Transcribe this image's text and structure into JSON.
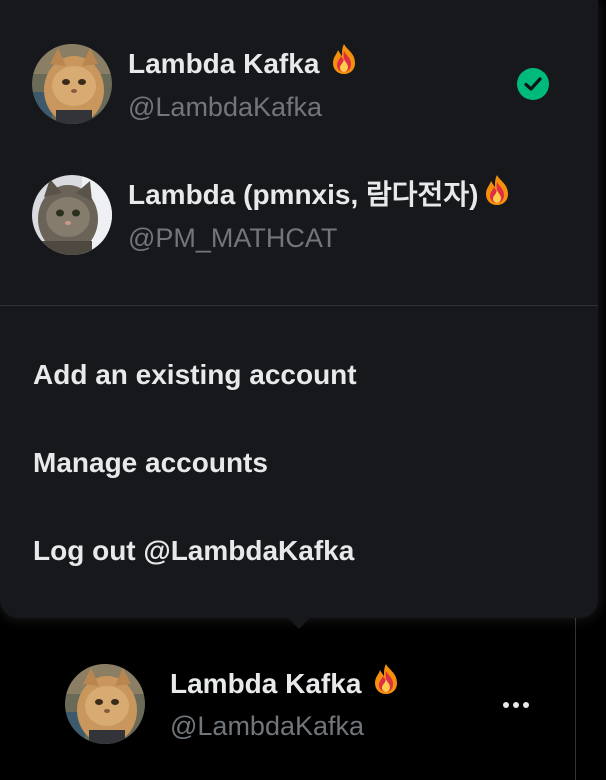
{
  "accounts": [
    {
      "name": "Lambda Kafka",
      "handle": "@LambdaKafka",
      "badge": "fire-emoji",
      "active": true
    },
    {
      "name": "Lambda (pmnxis, 람다전자)",
      "handle": "@PM_MATHCAT",
      "badge": "fire-emoji",
      "active": false
    }
  ],
  "menu": {
    "add_account": "Add an existing account",
    "manage_accounts": "Manage accounts",
    "log_out": "Log out @LambdaKafka"
  },
  "current_user": {
    "name": "Lambda Kafka",
    "handle": "@LambdaKafka",
    "more_icon": "more-horizontal-icon"
  },
  "colors": {
    "background": "#000000",
    "popup": "#16181c",
    "text": "#e7e9ea",
    "secondary_text": "#71767b",
    "check": "#00ba7c",
    "divider": "#2f3336"
  }
}
